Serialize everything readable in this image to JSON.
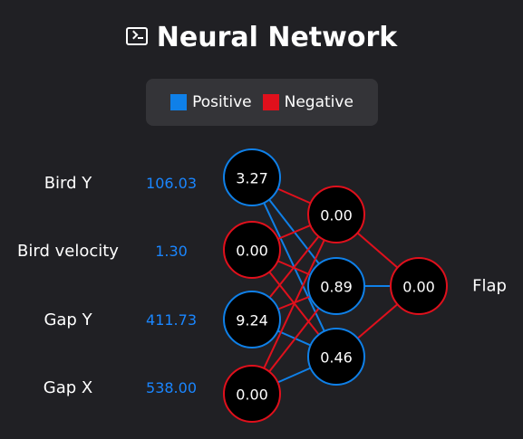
{
  "header": {
    "title": "Neural Network",
    "icon": "terminal-icon"
  },
  "legend": {
    "positive_label": "Positive",
    "negative_label": "Negative",
    "positive_color": "#0f80e8",
    "negative_color": "#e0101c"
  },
  "inputs": [
    {
      "label": "Bird Y",
      "value": "106.03",
      "node_value": "3.27",
      "sign": "positive"
    },
    {
      "label": "Bird velocity",
      "value": "1.30",
      "node_value": "0.00",
      "sign": "negative"
    },
    {
      "label": "Gap Y",
      "value": "411.73",
      "node_value": "9.24",
      "sign": "positive"
    },
    {
      "label": "Gap X",
      "value": "538.00",
      "node_value": "0.00",
      "sign": "negative"
    }
  ],
  "hidden": [
    {
      "node_value": "0.00",
      "sign": "negative"
    },
    {
      "node_value": "0.89",
      "sign": "positive"
    },
    {
      "node_value": "0.46",
      "sign": "positive"
    }
  ],
  "output": {
    "label": "Flap",
    "node_value": "0.00",
    "sign": "negative"
  },
  "connections_input_hidden": [
    [
      "negative",
      "positive",
      "positive"
    ],
    [
      "negative",
      "negative",
      "negative"
    ],
    [
      "negative",
      "negative",
      "positive"
    ],
    [
      "negative",
      "negative",
      "positive"
    ]
  ],
  "connections_hidden_output": [
    "negative",
    "positive",
    "negative"
  ]
}
